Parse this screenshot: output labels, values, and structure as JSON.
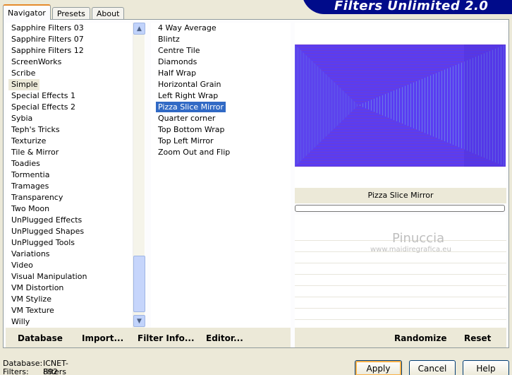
{
  "tabs": [
    {
      "label": "Navigator",
      "active": true
    },
    {
      "label": "Presets",
      "active": false
    },
    {
      "label": "About",
      "active": false
    }
  ],
  "banner_title": "Filters Unlimited 2.0",
  "categories": [
    "Sapphire Filters 03",
    "Sapphire Filters 07",
    "Sapphire Filters 12",
    "ScreenWorks",
    "Scribe",
    "Simple",
    "Special Effects 1",
    "Special Effects 2",
    "Sybia",
    "Teph's Tricks",
    "Texturize",
    "Tile & Mirror",
    "Toadies",
    "Tormentia",
    "Tramages",
    "Transparency",
    "Two Moon",
    "UnPlugged Effects",
    "UnPlugged Shapes",
    "UnPlugged Tools",
    "Variations",
    "Video",
    "Visual Manipulation",
    "VM Distortion",
    "VM Stylize",
    "VM Texture",
    "Willy"
  ],
  "selected_category": "Simple",
  "filters": [
    "4 Way Average",
    "Blintz",
    "Centre Tile",
    "Diamonds",
    "Half Wrap",
    "Horizontal Grain",
    "Left Right Wrap",
    "Pizza Slice Mirror",
    "Quarter corner",
    "Top Bottom Wrap",
    "Top Left Mirror",
    "Zoom Out and Flip"
  ],
  "selected_filter": "Pizza Slice Mirror",
  "filter_name_display": "Pizza Slice Mirror",
  "watermark": {
    "name": "Pinuccia",
    "site": "www.maidiregrafica.eu"
  },
  "left_actions": {
    "database": "Database",
    "import": "Import...",
    "filter_info": "Filter Info...",
    "editor": "Editor..."
  },
  "right_actions": {
    "randomize": "Randomize",
    "reset": "Reset"
  },
  "info": {
    "database_label": "Database:",
    "database_value": "ICNET-Filters",
    "filters_label": "Filters:",
    "filters_value": "892"
  },
  "buttons": {
    "apply": "Apply",
    "cancel": "Cancel",
    "help": "Help"
  },
  "colors": {
    "accent": "#316ac5",
    "banner": "#000b8a",
    "preview_main": "#5b3ff0"
  }
}
